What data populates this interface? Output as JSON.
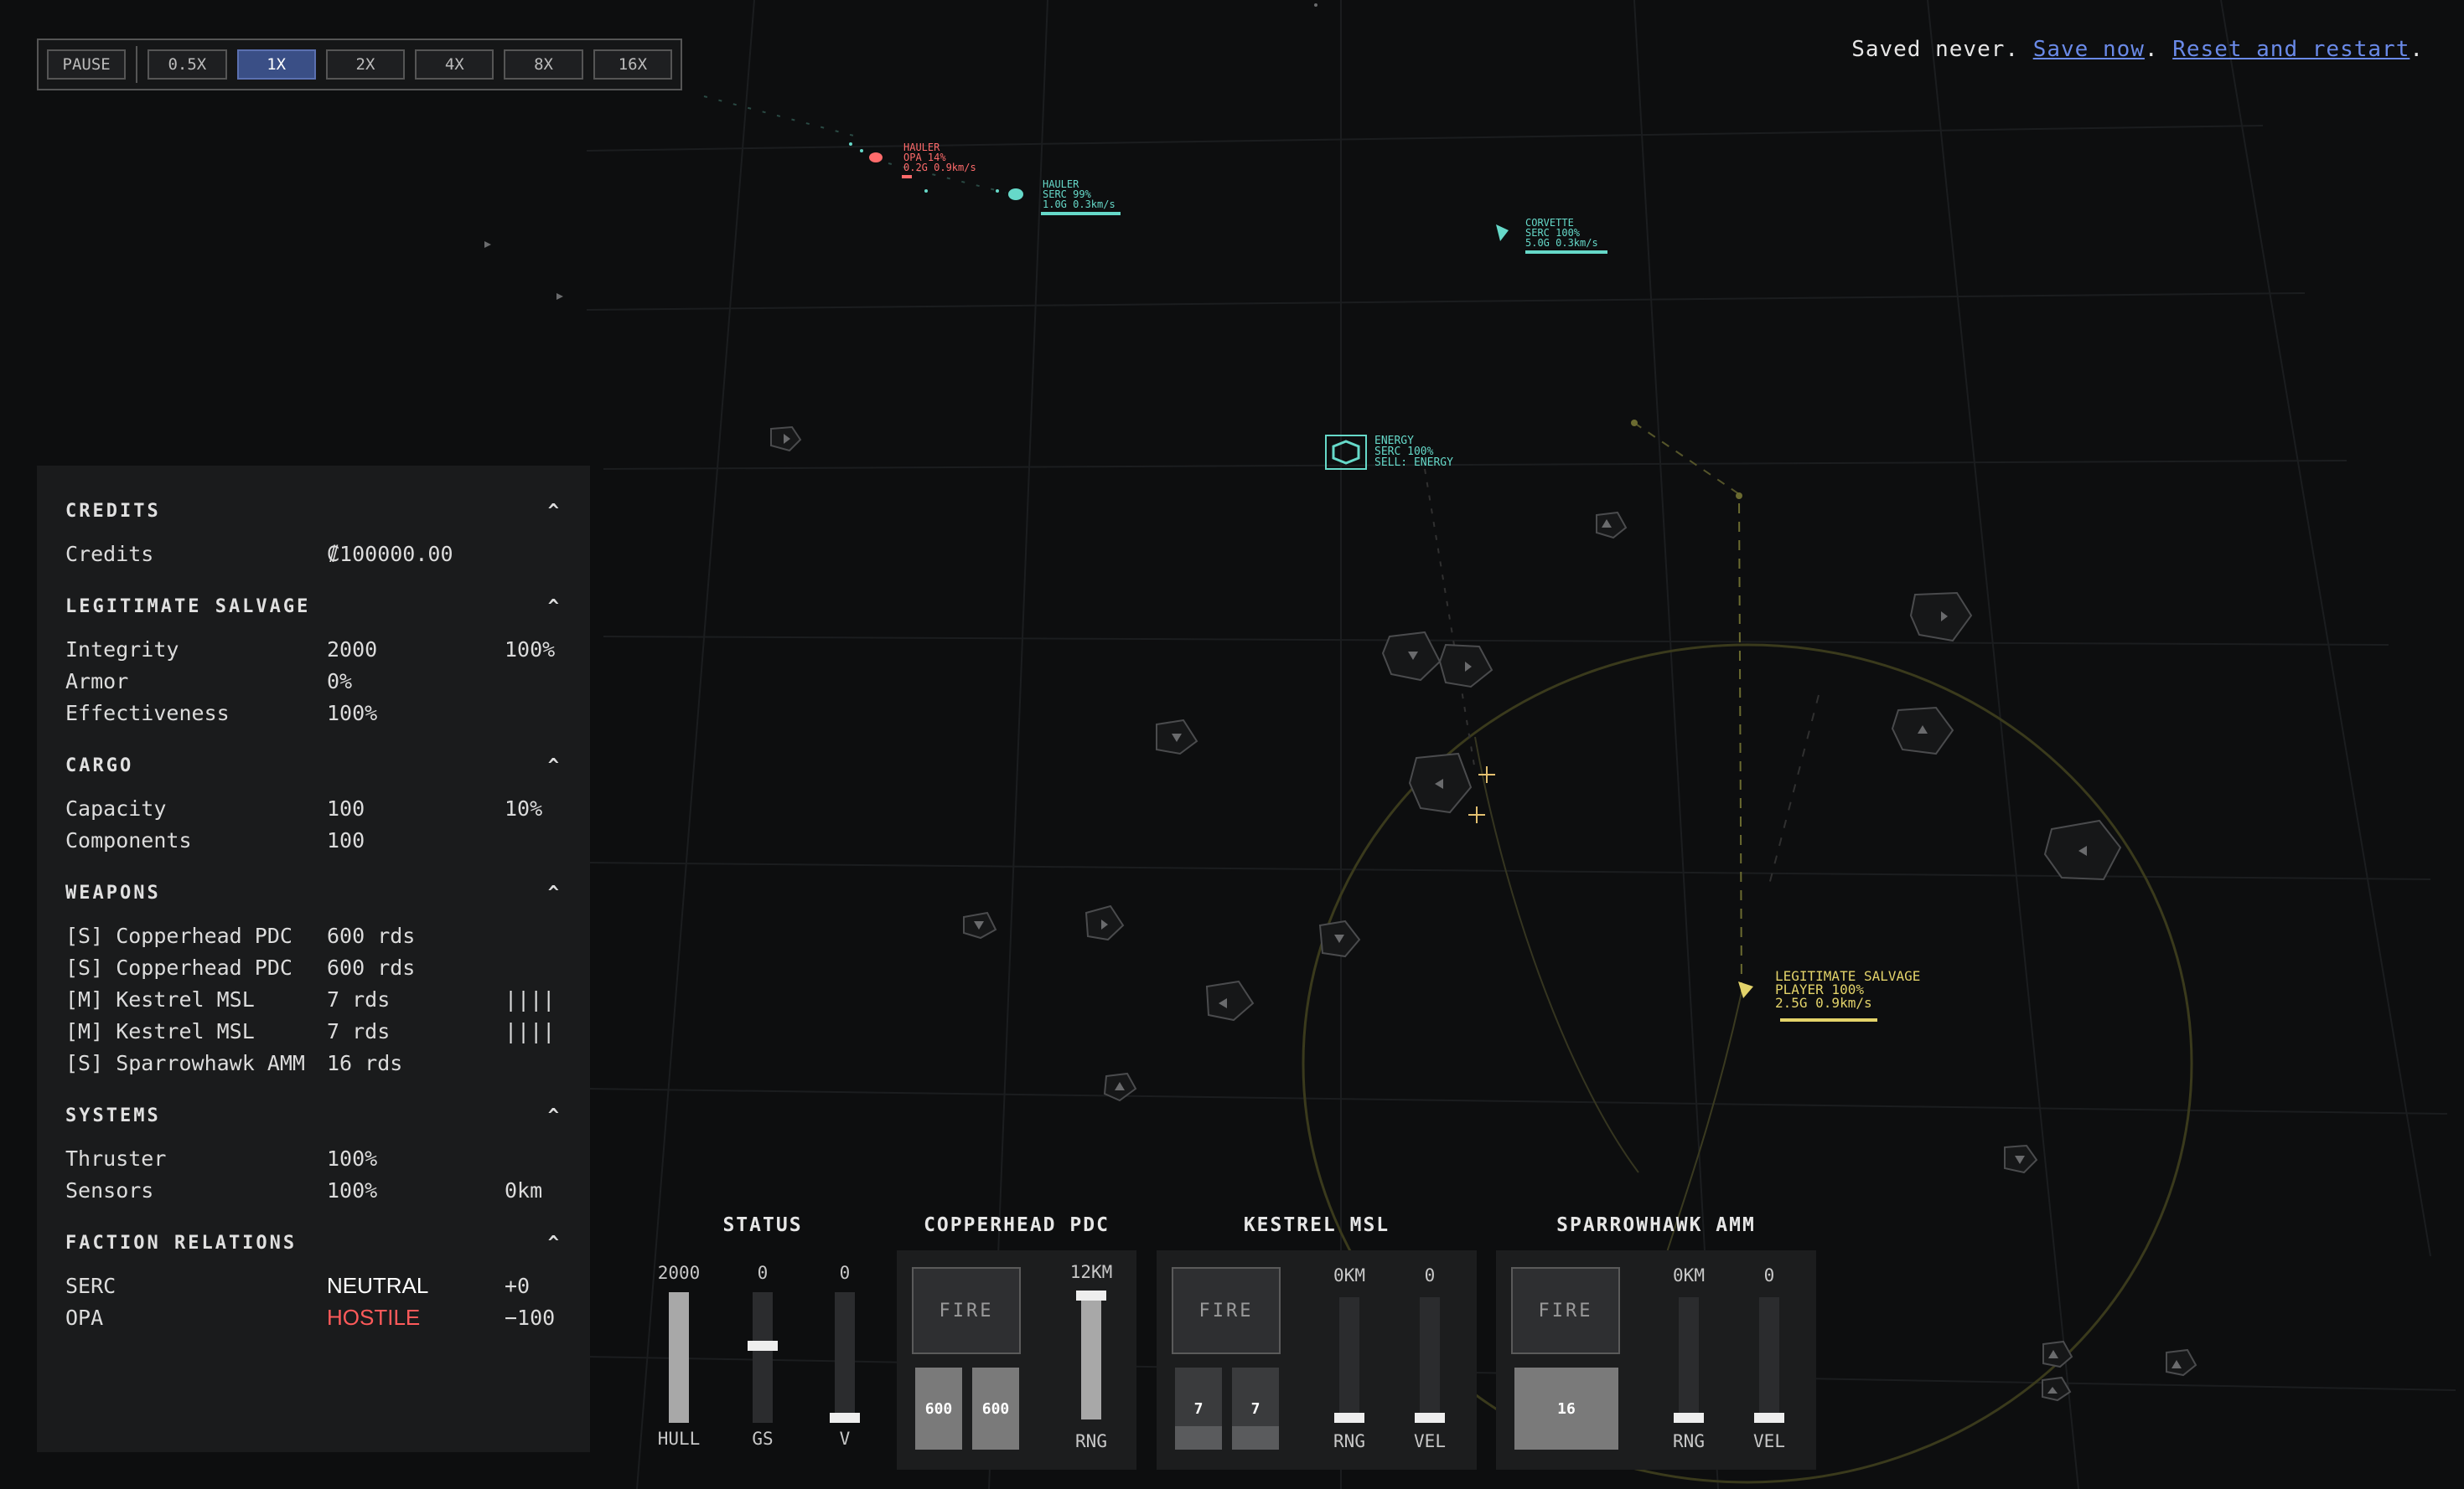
{
  "speed_controls": {
    "pause_label": "PAUSE",
    "speeds": [
      {
        "label": "0.5X",
        "active": false
      },
      {
        "label": "1X",
        "active": true
      },
      {
        "label": "2X",
        "active": false
      },
      {
        "label": "4X",
        "active": false
      },
      {
        "label": "8X",
        "active": false
      },
      {
        "label": "16X",
        "active": false
      }
    ]
  },
  "save": {
    "prefix": "Saved never.",
    "save_now": "Save now",
    "sep": ".",
    "reset": "Reset and restart",
    "suffix": "."
  },
  "map_labels": {
    "hauler_opa": [
      "HAULER",
      "OPA 14%",
      "0.2G 0.9km/s"
    ],
    "hauler_serc": [
      "HAULER",
      "SERC 99%",
      "1.0G 0.3km/s"
    ],
    "corvette": [
      "CORVETTE",
      "SERC 100%",
      "5.0G 0.3km/s"
    ],
    "station": [
      "ENERGY",
      "SERC 100%",
      "SELL: ENERGY"
    ],
    "player": [
      "LEGITIMATE SALVAGE",
      "PLAYER 100%",
      "2.5G 0.9km/s"
    ]
  },
  "colors": {
    "hostile": "#ff6b6b",
    "serc": "#66d9c9",
    "player": "#e3d36a",
    "accent": "#3a4f86"
  },
  "panel": {
    "credits": {
      "title": "CREDITS",
      "rows": [
        {
          "label": "Credits",
          "value": "₡100000.00",
          "extra": ""
        }
      ]
    },
    "ship": {
      "title": "LEGITIMATE SALVAGE",
      "rows": [
        {
          "label": "Integrity",
          "value": "2000",
          "extra": "100%"
        },
        {
          "label": "Armor",
          "value": "0%",
          "extra": ""
        },
        {
          "label": "Effectiveness",
          "value": "100%",
          "extra": ""
        }
      ]
    },
    "cargo": {
      "title": "CARGO",
      "rows": [
        {
          "label": "Capacity",
          "value": "100",
          "extra": "10%"
        },
        {
          "label": "Components",
          "value": "100",
          "extra": ""
        }
      ]
    },
    "weapons": {
      "title": "WEAPONS",
      "rows": [
        {
          "label": "[S] Copperhead PDC",
          "value": "600 rds",
          "extra": ""
        },
        {
          "label": "[S] Copperhead PDC",
          "value": "600 rds",
          "extra": ""
        },
        {
          "label": "[M] Kestrel MSL",
          "value": "7 rds",
          "extra": "||||"
        },
        {
          "label": "[M] Kestrel MSL",
          "value": "7 rds",
          "extra": "||||"
        },
        {
          "label": "[S] Sparrowhawk AMM",
          "value": "16 rds",
          "extra": ""
        }
      ]
    },
    "systems": {
      "title": "SYSTEMS",
      "rows": [
        {
          "label": "Thruster",
          "value": "100%",
          "extra": ""
        },
        {
          "label": "Sensors",
          "value": "100%",
          "extra": "0km"
        }
      ]
    },
    "factions": {
      "title": "FACTION RELATIONS",
      "rows": [
        {
          "label": "SERC",
          "value": "NEUTRAL",
          "extra": "+0"
        },
        {
          "label": "OPA",
          "value": "HOSTILE",
          "extra": "−100"
        }
      ]
    }
  },
  "controls": {
    "status": {
      "title": "STATUS",
      "hull_value": "2000",
      "hull_label": "HULL",
      "hull_fraction": 1.0,
      "gs_value": "0",
      "gs_label": "GS",
      "gs_fraction": 0.6,
      "v_value": "0",
      "v_label": "V",
      "v_fraction": 0.0
    },
    "pdc": {
      "title": "COPPERHEAD PDC",
      "fire_label": "FIRE",
      "ammo": [
        "600",
        "600"
      ],
      "rng_value": "12KM",
      "rng_label": "RNG",
      "rng_fraction": 1.0
    },
    "kestrel": {
      "title": "KESTREL MSL",
      "fire_label": "FIRE",
      "ammo": [
        "7",
        "7"
      ],
      "rng_value": "0KM",
      "rng_label": "RNG",
      "vel_value": "0",
      "vel_label": "VEL"
    },
    "sparrow": {
      "title": "SPARROWHAWK AMM",
      "fire_label": "FIRE",
      "ammo": [
        "16"
      ],
      "rng_value": "0KM",
      "rng_label": "RNG",
      "vel_value": "0",
      "vel_label": "VEL"
    }
  }
}
